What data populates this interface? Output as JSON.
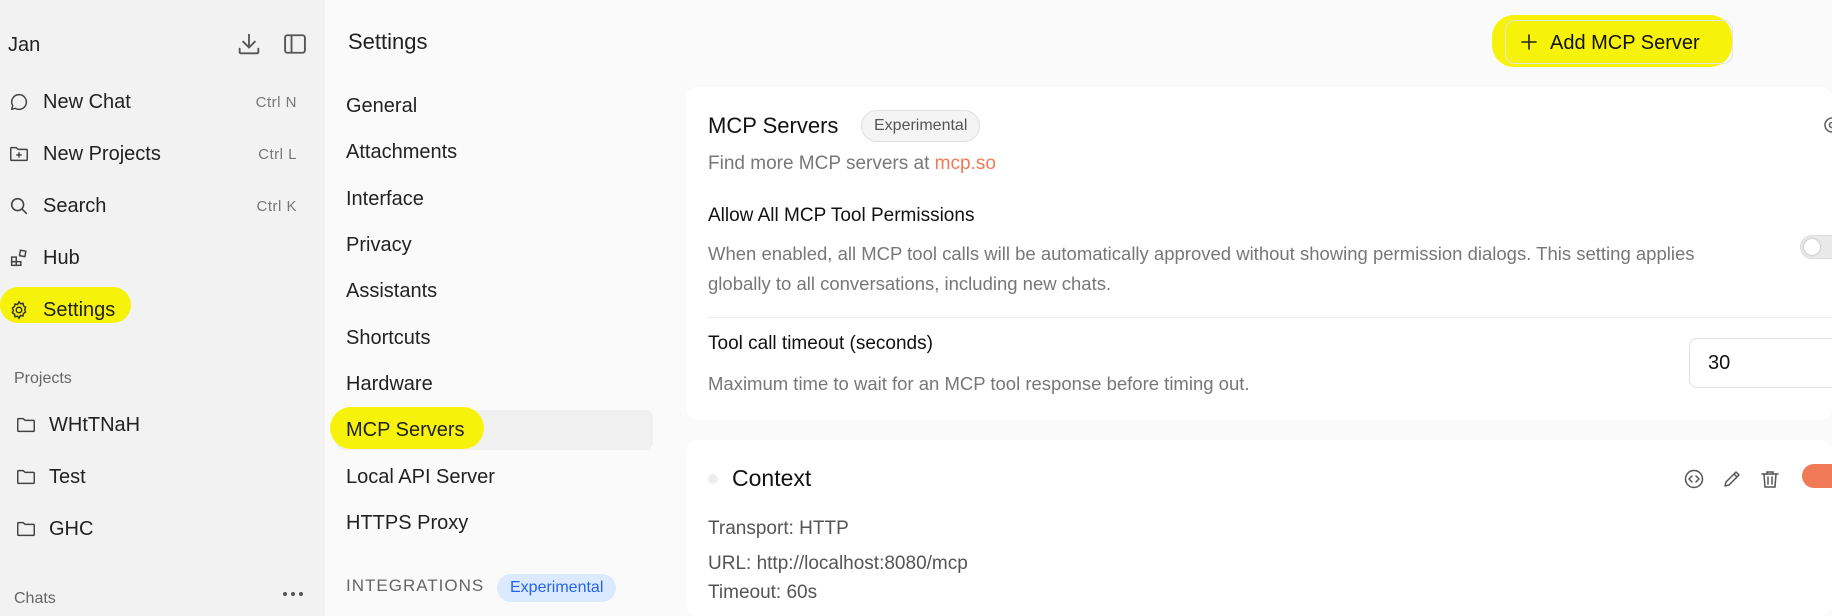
{
  "sidebar": {
    "app_name": "Jan",
    "nav": [
      {
        "label": "New Chat",
        "shortcut": "Ctrl N"
      },
      {
        "label": "New Projects",
        "shortcut": "Ctrl L"
      },
      {
        "label": "Search",
        "shortcut": "Ctrl K"
      },
      {
        "label": "Hub",
        "shortcut": ""
      },
      {
        "label": "Settings",
        "shortcut": ""
      }
    ],
    "projects_label": "Projects",
    "projects": [
      {
        "label": "WHtTNaH"
      },
      {
        "label": "Test"
      },
      {
        "label": "GHC"
      }
    ],
    "chats_label": "Chats"
  },
  "settings_nav": {
    "title": "Settings",
    "items": [
      {
        "label": "General"
      },
      {
        "label": "Attachments"
      },
      {
        "label": "Interface"
      },
      {
        "label": "Privacy"
      },
      {
        "label": "Assistants"
      },
      {
        "label": "Shortcuts"
      },
      {
        "label": "Hardware"
      },
      {
        "label": "MCP Servers"
      },
      {
        "label": "Local API Server"
      },
      {
        "label": "HTTPS Proxy"
      }
    ],
    "integrations_label": "INTEGRATIONS",
    "integrations_badge": "Experimental"
  },
  "header": {
    "add_button_label": "Add MCP Server"
  },
  "mcp_card": {
    "title": "MCP Servers",
    "badge": "Experimental",
    "subtitle_prefix": "Find more MCP servers at",
    "subtitle_link": "mcp.so",
    "allow_title": "Allow All MCP Tool Permissions",
    "allow_desc": "When enabled, all MCP tool calls will be automatically approved without showing permission dialogs. This setting applies globally to all conversations, including new chats.",
    "allow_enabled": false,
    "timeout_title": "Tool call timeout (seconds)",
    "timeout_desc": "Maximum time to wait for an MCP tool response before timing out.",
    "timeout_value": "30"
  },
  "server_card": {
    "name": "Context",
    "enabled": true,
    "transport": "Transport: HTTP",
    "url": "URL: http://localhost:8080/mcp",
    "timeout": "Timeout: 60s"
  },
  "colors": {
    "highlight": "#f7f20a",
    "accent": "#f07a55",
    "badge_blue_bg": "#dbeafe",
    "badge_blue_text": "#2563eb"
  }
}
